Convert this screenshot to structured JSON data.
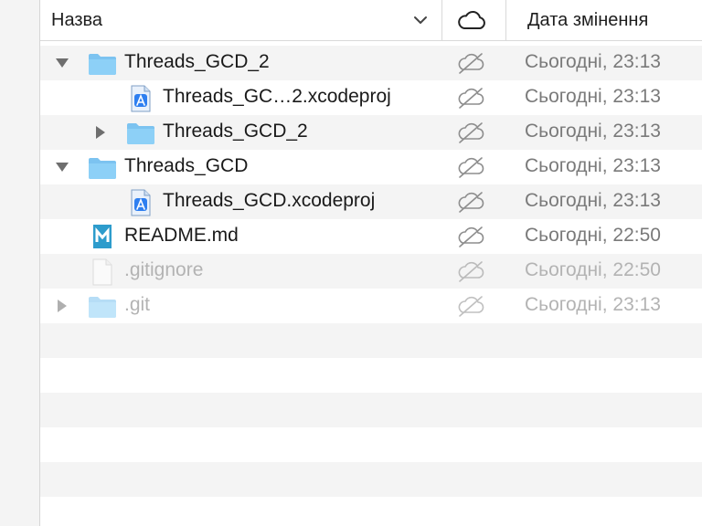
{
  "header": {
    "name_label": "Назва",
    "date_label": "Дата змінення",
    "icloud_icon": "cloud-icon",
    "sort_icon": "chevron-down-icon"
  },
  "colors": {
    "folder": "#7cc3f0",
    "alt_row": "#f4f4f4",
    "date_text": "#7a7a7a",
    "dim_text": "#b3b3b3"
  },
  "rows": [
    {
      "name": "Threads_GCD_2",
      "icon": "folder-icon",
      "disclosure": "expanded",
      "date": "Сьогодні, 23:13",
      "dim": false
    },
    {
      "name": "Threads_GC…2.xcodeproj",
      "icon": "xcodeproj-icon",
      "disclosure": "none",
      "date": "Сьогодні, 23:13",
      "dim": false
    },
    {
      "name": "Threads_GCD_2",
      "icon": "folder-icon",
      "disclosure": "collapsed",
      "date": "Сьогодні, 23:13",
      "dim": false
    },
    {
      "name": "Threads_GCD",
      "icon": "folder-icon",
      "disclosure": "expanded",
      "date": "Сьогодні, 23:13",
      "dim": false
    },
    {
      "name": "Threads_GCD.xcodeproj",
      "icon": "xcodeproj-icon",
      "disclosure": "none",
      "date": "Сьогодні, 23:13",
      "dim": false
    },
    {
      "name": "README.md",
      "icon": "markdown-icon",
      "disclosure": "none",
      "date": "Сьогодні, 22:50",
      "dim": false
    },
    {
      "name": ".gitignore",
      "icon": "blank-file-icon",
      "disclosure": "none",
      "date": "Сьогодні, 22:50",
      "dim": true
    },
    {
      "name": ".git",
      "icon": "folder-icon",
      "disclosure": "collapsed",
      "date": "Сьогодні, 23:13",
      "dim": true
    }
  ]
}
